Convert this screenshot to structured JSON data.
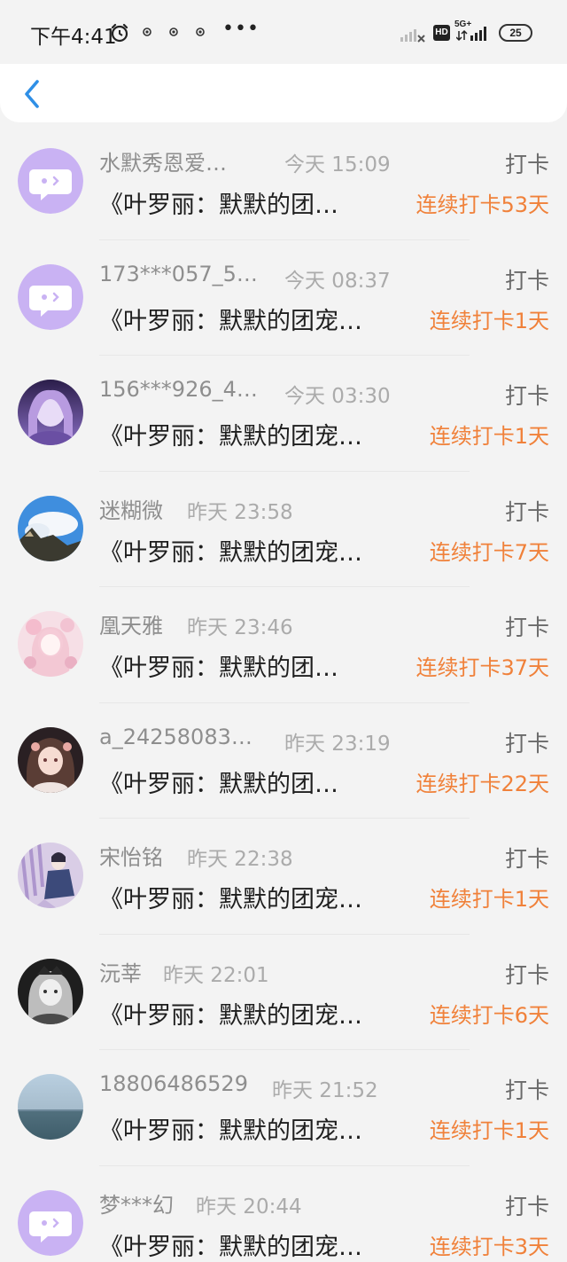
{
  "status_bar": {
    "time": "下午4:41",
    "battery": "25",
    "network": "5G+",
    "hd": "HD"
  },
  "header": {
    "back_icon": "chevron-left-icon"
  },
  "records": [
    {
      "username": "水默秀恩爱…",
      "time": "今天 15:09",
      "type": "打卡",
      "title": "《叶罗丽：默默的团…",
      "streak": "连续打卡53天",
      "avatar": "default-chat"
    },
    {
      "username": "173***057_5…",
      "time": "今天 08:37",
      "type": "打卡",
      "title": "《叶罗丽：默默的团宠…",
      "streak": "连续打卡1天",
      "avatar": "default-chat"
    },
    {
      "username": "156***926_4…",
      "time": "今天 03:30",
      "type": "打卡",
      "title": "《叶罗丽：默默的团宠…",
      "streak": "连续打卡1天",
      "avatar": "photo-purple-anime"
    },
    {
      "username": "迷糊微",
      "time": "昨天 23:58",
      "type": "打卡",
      "title": "《叶罗丽：默默的团宠…",
      "streak": "连续打卡7天",
      "avatar": "photo-sky-landscape"
    },
    {
      "username": "凰天雅",
      "time": "昨天 23:46",
      "type": "打卡",
      "title": "《叶罗丽：默默的团…",
      "streak": "连续打卡37天",
      "avatar": "photo-pink-anime"
    },
    {
      "username": "a_24258083…",
      "time": "昨天 23:19",
      "type": "打卡",
      "title": "《叶罗丽：默默的团…",
      "streak": "连续打卡22天",
      "avatar": "photo-dark-anime-girl"
    },
    {
      "username": "宋怡铭",
      "time": "昨天 22:38",
      "type": "打卡",
      "title": "《叶罗丽：默默的团宠…",
      "streak": "连续打卡1天",
      "avatar": "photo-lavender-anime"
    },
    {
      "username": "沅莘",
      "time": "昨天 22:01",
      "type": "打卡",
      "title": "《叶罗丽：默默的团宠…",
      "streak": "连续打卡6天",
      "avatar": "photo-gothic-anime"
    },
    {
      "username": "18806486529",
      "time": "昨天 21:52",
      "type": "打卡",
      "title": "《叶罗丽：默默的团宠…",
      "streak": "连续打卡1天",
      "avatar": "photo-sea-horizon"
    },
    {
      "username": "梦***幻",
      "time": "昨天 20:44",
      "type": "打卡",
      "title": "《叶罗丽：默默的团宠…",
      "streak": "连续打卡3天",
      "avatar": "default-chat"
    }
  ],
  "colors": {
    "accent_orange": "#f0813a",
    "back_blue": "#2f8fe6",
    "default_avatar_purple": "#c9b2f3"
  }
}
